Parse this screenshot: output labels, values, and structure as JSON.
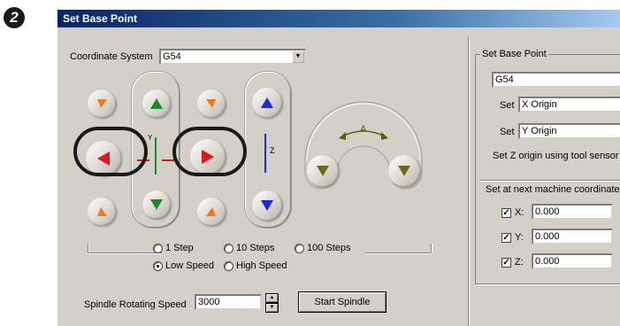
{
  "step_marker": "2",
  "window": {
    "title": "Set Base Point"
  },
  "coordinate_system": {
    "label": "Coordinate System",
    "value": "G54"
  },
  "jog": {
    "axis_xy_label": "Y",
    "axis_z_label": "Z",
    "axis_a_label": "A"
  },
  "step_options": [
    {
      "label": "1 Step",
      "selected": false
    },
    {
      "label": "10 Steps",
      "selected": false
    },
    {
      "label": "100 Steps",
      "selected": false
    }
  ],
  "speed_options": [
    {
      "label": "Low Speed",
      "selected": true
    },
    {
      "label": "High Speed",
      "selected": false
    }
  ],
  "spindle": {
    "label": "Spindle Rotating Speed",
    "value": "3000",
    "button": "Start Spindle"
  },
  "right_panel": {
    "group_title": "Set Base Point",
    "coord_value": "G54",
    "set_label_1": "Set",
    "set_value_1": "X Origin",
    "set_label_2": "Set",
    "set_value_2": "Y Origin",
    "z_origin_text": "Set Z origin using tool sensor",
    "machine_coord_title": "Set at next machine coordinates",
    "x": {
      "label": "X:",
      "value": "0.000",
      "checked": true
    },
    "y": {
      "label": "Y:",
      "value": "0.000",
      "checked": true
    },
    "z": {
      "label": "Z:",
      "value": "0.000",
      "checked": true
    }
  },
  "colors": {
    "orange": "#f07a1a",
    "green": "#1a8a2a",
    "red": "#e0141c",
    "blue": "#1a2ae0",
    "olive": "#6e6a10"
  }
}
